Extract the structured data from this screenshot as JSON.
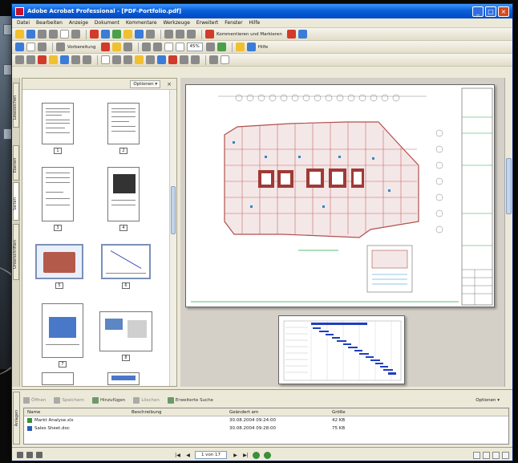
{
  "window": {
    "title": "Adobe Acrobat Professional - [PDF-Portfolio.pdf]",
    "minimize": "_",
    "maximize": "□",
    "close": "×"
  },
  "menu": [
    "Datei",
    "Bearbeiten",
    "Anzeige",
    "Dokument",
    "Kommentare",
    "Werkzeuge",
    "Erweitert",
    "Fenster",
    "Hilfe"
  ],
  "toolbar": {
    "comment_label": "Kommentieren und Markieren",
    "review_label": "Vorbereitung",
    "zoom_value": "45%",
    "help_label": "Hilfe"
  },
  "side_tabs": [
    "Lesezeichen",
    "Seiten",
    "Ebenen",
    "Unterschriften"
  ],
  "pages_panel": {
    "options_label": "Optionen ▾",
    "close": "×",
    "page_numbers": [
      "1",
      "2",
      "3",
      "4",
      "5",
      "6",
      "7",
      "8"
    ]
  },
  "attachments": {
    "tab_label": "Anlagen",
    "buttons": [
      "Öffnen",
      "Speichern",
      "Hinzufügen",
      "Löschen",
      "Erweiterte Suche"
    ],
    "options_label": "Optionen ▾",
    "columns": [
      "Name",
      "Beschreibung",
      "Geändert am",
      "Größe"
    ],
    "rows": [
      {
        "name": "Markt Analyse.xls",
        "description": "",
        "modified": "30.08.2004 09:24:00",
        "size": "42 KB"
      },
      {
        "name": "Sales Sheet.doc",
        "description": "",
        "modified": "30.08.2004 09:28:00",
        "size": "75 KB"
      }
    ]
  },
  "status": {
    "page_display": "1 von 17"
  },
  "colors": {
    "titlebar": "#0a5fd8",
    "chrome": "#ece9d8",
    "doc_bg": "#d4d0c8",
    "plan_red": "#c0504d",
    "plan_green": "#2ea44f",
    "gantt_blue": "#1f3fbf"
  }
}
